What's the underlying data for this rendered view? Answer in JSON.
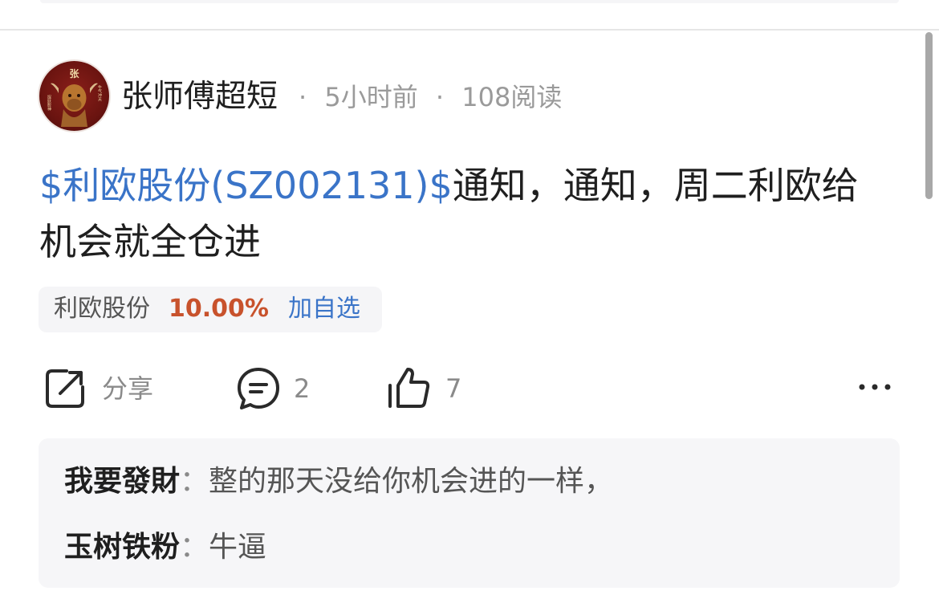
{
  "post": {
    "author": "张师傅超短",
    "time": "5小时前",
    "reads": "108阅读",
    "meta_dot": "·",
    "stock_link": "$利欧股份(SZ002131)$",
    "body_text": "通知，通知，周二利欧给机会就全仓进"
  },
  "avatar": {
    "top_char": "张",
    "left_text": "捉妖股神",
    "right_text": "牛气冲天"
  },
  "stock_chip": {
    "name": "利欧股份",
    "change": "10.00%",
    "add_label": "加自选"
  },
  "actions": {
    "share_label": "分享",
    "comment_count": "2",
    "like_count": "7"
  },
  "comments": [
    {
      "author": "我要發財",
      "sep": "：",
      "text": "整的那天没给你机会进的一样，"
    },
    {
      "author": "玉树铁粉",
      "sep": "：",
      "text": "牛逼"
    }
  ],
  "colors": {
    "link": "#3a74c8",
    "up": "#c8522c"
  }
}
